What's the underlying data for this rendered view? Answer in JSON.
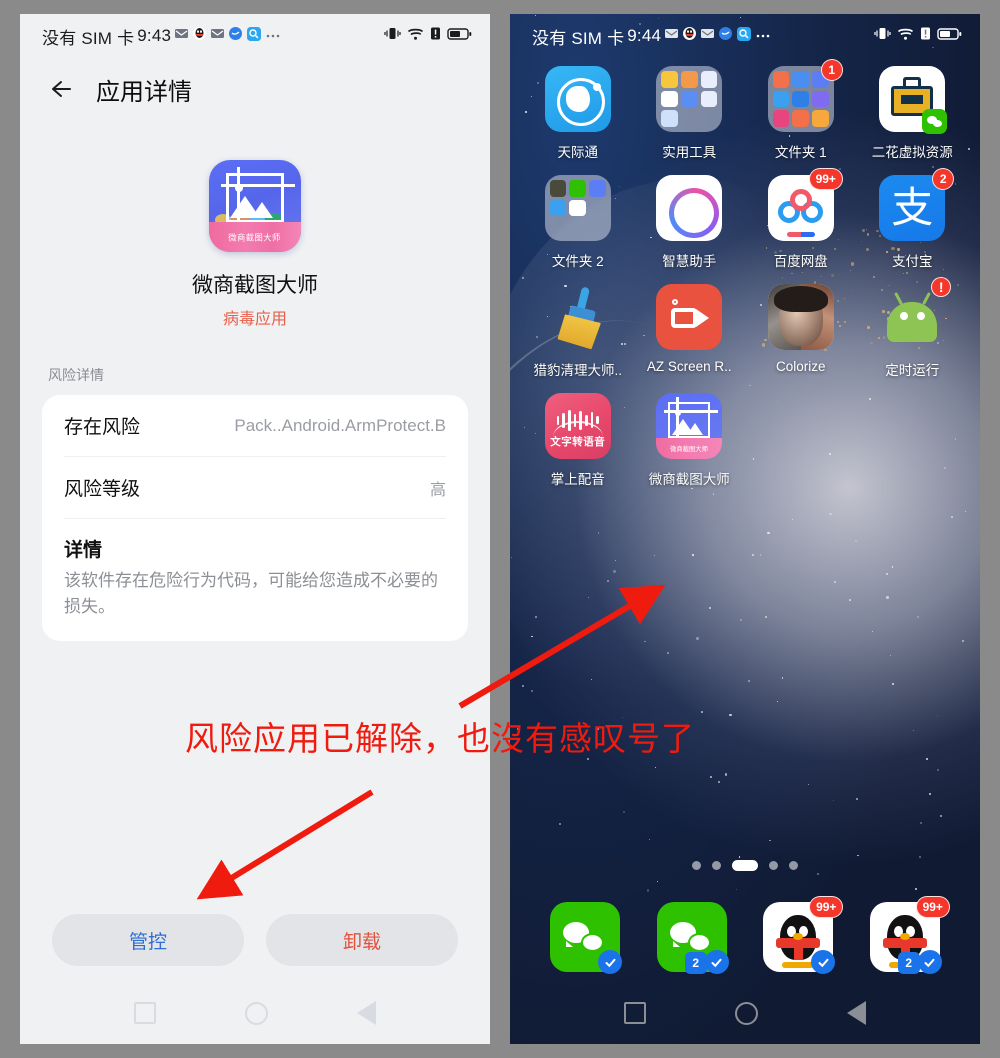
{
  "left_panel": {
    "statusbar": {
      "carrier": "没有 SIM 卡",
      "time": "9:43",
      "notif_icons": [
        "mail-icon",
        "qq-penguin-icon",
        "mail-icon",
        "browser-icon",
        "search-icon",
        "more-dots-icon"
      ],
      "right_icons": [
        "vibrate-icon",
        "wifi-icon",
        "signal-alert-icon",
        "battery-icon"
      ]
    },
    "header": {
      "back_label": "←",
      "title": "应用详情"
    },
    "app": {
      "icon_label": "微商截图大师",
      "name": "微商截图大师",
      "risk_status": "病毒应用",
      "risk_status_color": "#e8604c"
    },
    "section_label": "风险详情",
    "rows": [
      {
        "key": "存在风险",
        "value": "Pack..Android.ArmProtect.B"
      },
      {
        "key": "风险等级",
        "value": "高"
      }
    ],
    "detail": {
      "title": "详情",
      "text": "该软件存在危险行为代码，可能给您造成不必要的损失。"
    },
    "buttons": [
      {
        "label": "管控",
        "color": "#2f6dd0"
      },
      {
        "label": "卸载",
        "color": "#e0523d"
      }
    ],
    "navbar": [
      "recents-square-icon",
      "home-circle-icon",
      "back-triangle-icon"
    ]
  },
  "right_panel": {
    "statusbar": {
      "carrier": "没有 SIM 卡",
      "time": "9:44",
      "notif_icons": [
        "mail-icon",
        "qq-penguin-icon",
        "mail-icon",
        "browser-icon",
        "search-icon",
        "more-dots-icon"
      ],
      "right_icons": [
        "vibrate-icon",
        "wifi-icon",
        "signal-alert-icon",
        "battery-icon"
      ]
    },
    "apps": [
      {
        "label": "天际通",
        "icon": "globe-app-icon",
        "badge": ""
      },
      {
        "label": "实用工具",
        "icon": "folder-icon",
        "badge": ""
      },
      {
        "label": "文件夹 1",
        "icon": "folder-icon",
        "badge": "1"
      },
      {
        "label": "二花虚拟资源",
        "icon": "briefcase-app-icon",
        "badge": ""
      },
      {
        "label": "文件夹 2",
        "icon": "folder-icon",
        "badge": ""
      },
      {
        "label": "智慧助手",
        "icon": "assistant-ring-icon",
        "badge": ""
      },
      {
        "label": "百度网盘",
        "icon": "baidu-netdisk-icon",
        "badge": "99+"
      },
      {
        "label": "支付宝",
        "icon": "alipay-icon",
        "badge": "2"
      },
      {
        "label": "猎豹清理大师..",
        "icon": "broom-clean-icon",
        "badge": ""
      },
      {
        "label": "AZ Screen R..",
        "icon": "camcorder-icon",
        "badge": ""
      },
      {
        "label": "Colorize",
        "icon": "portrait-photo-icon",
        "badge": ""
      },
      {
        "label": "定时运行",
        "icon": "android-robot-icon",
        "badge": "!"
      },
      {
        "label": "掌上配音",
        "icon": "text-to-speech-icon",
        "icon_text": "文字转语音",
        "badge": ""
      },
      {
        "label": "微商截图大师",
        "icon": "screenshot-master-icon",
        "icon_text": "微商截图大师",
        "badge": ""
      }
    ],
    "page_indicator": {
      "total": 5,
      "active": 3
    },
    "dock": [
      {
        "icon": "wechat-icon",
        "badge": "",
        "check": true,
        "dual": ""
      },
      {
        "icon": "wechat-icon",
        "badge": "",
        "check": true,
        "dual": "2"
      },
      {
        "icon": "qq-icon",
        "badge": "99+",
        "check": true,
        "dual": ""
      },
      {
        "icon": "qq-icon",
        "badge": "99+",
        "check": true,
        "dual": "2"
      }
    ],
    "navbar": [
      "recents-square-icon",
      "home-circle-icon",
      "back-triangle-icon"
    ]
  },
  "annotation": {
    "text": "风险应用已解除，也沒有感叹号了",
    "color": "#ef1b0f",
    "arrows": [
      {
        "name": "arrow-to-app-icon",
        "from": [
          460,
          706
        ],
        "to": [
          658,
          589
        ]
      },
      {
        "name": "arrow-to-manage-button",
        "from": [
          372,
          792
        ],
        "to": [
          203,
          896
        ]
      }
    ]
  }
}
